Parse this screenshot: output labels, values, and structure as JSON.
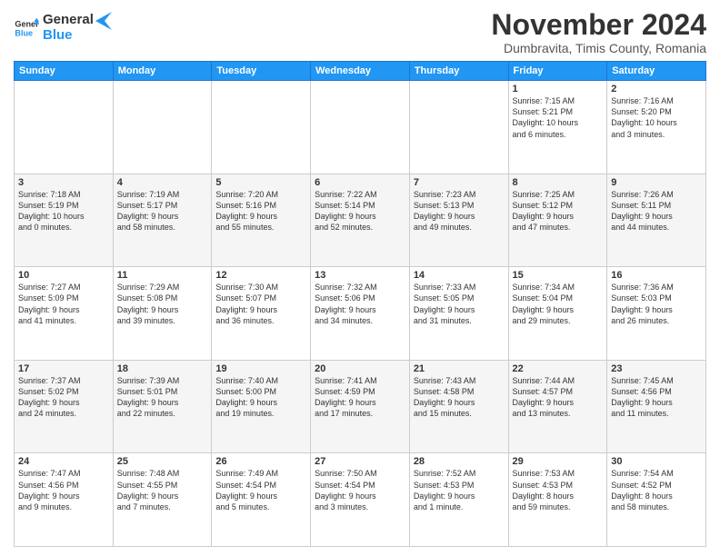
{
  "logo": {
    "line1": "General",
    "line2": "Blue"
  },
  "title": "November 2024",
  "subtitle": "Dumbravita, Timis County, Romania",
  "headers": [
    "Sunday",
    "Monday",
    "Tuesday",
    "Wednesday",
    "Thursday",
    "Friday",
    "Saturday"
  ],
  "weeks": [
    [
      {
        "day": "",
        "info": ""
      },
      {
        "day": "",
        "info": ""
      },
      {
        "day": "",
        "info": ""
      },
      {
        "day": "",
        "info": ""
      },
      {
        "day": "",
        "info": ""
      },
      {
        "day": "1",
        "info": "Sunrise: 7:15 AM\nSunset: 5:21 PM\nDaylight: 10 hours\nand 6 minutes."
      },
      {
        "day": "2",
        "info": "Sunrise: 7:16 AM\nSunset: 5:20 PM\nDaylight: 10 hours\nand 3 minutes."
      }
    ],
    [
      {
        "day": "3",
        "info": "Sunrise: 7:18 AM\nSunset: 5:19 PM\nDaylight: 10 hours\nand 0 minutes."
      },
      {
        "day": "4",
        "info": "Sunrise: 7:19 AM\nSunset: 5:17 PM\nDaylight: 9 hours\nand 58 minutes."
      },
      {
        "day": "5",
        "info": "Sunrise: 7:20 AM\nSunset: 5:16 PM\nDaylight: 9 hours\nand 55 minutes."
      },
      {
        "day": "6",
        "info": "Sunrise: 7:22 AM\nSunset: 5:14 PM\nDaylight: 9 hours\nand 52 minutes."
      },
      {
        "day": "7",
        "info": "Sunrise: 7:23 AM\nSunset: 5:13 PM\nDaylight: 9 hours\nand 49 minutes."
      },
      {
        "day": "8",
        "info": "Sunrise: 7:25 AM\nSunset: 5:12 PM\nDaylight: 9 hours\nand 47 minutes."
      },
      {
        "day": "9",
        "info": "Sunrise: 7:26 AM\nSunset: 5:11 PM\nDaylight: 9 hours\nand 44 minutes."
      }
    ],
    [
      {
        "day": "10",
        "info": "Sunrise: 7:27 AM\nSunset: 5:09 PM\nDaylight: 9 hours\nand 41 minutes."
      },
      {
        "day": "11",
        "info": "Sunrise: 7:29 AM\nSunset: 5:08 PM\nDaylight: 9 hours\nand 39 minutes."
      },
      {
        "day": "12",
        "info": "Sunrise: 7:30 AM\nSunset: 5:07 PM\nDaylight: 9 hours\nand 36 minutes."
      },
      {
        "day": "13",
        "info": "Sunrise: 7:32 AM\nSunset: 5:06 PM\nDaylight: 9 hours\nand 34 minutes."
      },
      {
        "day": "14",
        "info": "Sunrise: 7:33 AM\nSunset: 5:05 PM\nDaylight: 9 hours\nand 31 minutes."
      },
      {
        "day": "15",
        "info": "Sunrise: 7:34 AM\nSunset: 5:04 PM\nDaylight: 9 hours\nand 29 minutes."
      },
      {
        "day": "16",
        "info": "Sunrise: 7:36 AM\nSunset: 5:03 PM\nDaylight: 9 hours\nand 26 minutes."
      }
    ],
    [
      {
        "day": "17",
        "info": "Sunrise: 7:37 AM\nSunset: 5:02 PM\nDaylight: 9 hours\nand 24 minutes."
      },
      {
        "day": "18",
        "info": "Sunrise: 7:39 AM\nSunset: 5:01 PM\nDaylight: 9 hours\nand 22 minutes."
      },
      {
        "day": "19",
        "info": "Sunrise: 7:40 AM\nSunset: 5:00 PM\nDaylight: 9 hours\nand 19 minutes."
      },
      {
        "day": "20",
        "info": "Sunrise: 7:41 AM\nSunset: 4:59 PM\nDaylight: 9 hours\nand 17 minutes."
      },
      {
        "day": "21",
        "info": "Sunrise: 7:43 AM\nSunset: 4:58 PM\nDaylight: 9 hours\nand 15 minutes."
      },
      {
        "day": "22",
        "info": "Sunrise: 7:44 AM\nSunset: 4:57 PM\nDaylight: 9 hours\nand 13 minutes."
      },
      {
        "day": "23",
        "info": "Sunrise: 7:45 AM\nSunset: 4:56 PM\nDaylight: 9 hours\nand 11 minutes."
      }
    ],
    [
      {
        "day": "24",
        "info": "Sunrise: 7:47 AM\nSunset: 4:56 PM\nDaylight: 9 hours\nand 9 minutes."
      },
      {
        "day": "25",
        "info": "Sunrise: 7:48 AM\nSunset: 4:55 PM\nDaylight: 9 hours\nand 7 minutes."
      },
      {
        "day": "26",
        "info": "Sunrise: 7:49 AM\nSunset: 4:54 PM\nDaylight: 9 hours\nand 5 minutes."
      },
      {
        "day": "27",
        "info": "Sunrise: 7:50 AM\nSunset: 4:54 PM\nDaylight: 9 hours\nand 3 minutes."
      },
      {
        "day": "28",
        "info": "Sunrise: 7:52 AM\nSunset: 4:53 PM\nDaylight: 9 hours\nand 1 minute."
      },
      {
        "day": "29",
        "info": "Sunrise: 7:53 AM\nSunset: 4:53 PM\nDaylight: 8 hours\nand 59 minutes."
      },
      {
        "day": "30",
        "info": "Sunrise: 7:54 AM\nSunset: 4:52 PM\nDaylight: 8 hours\nand 58 minutes."
      }
    ]
  ]
}
